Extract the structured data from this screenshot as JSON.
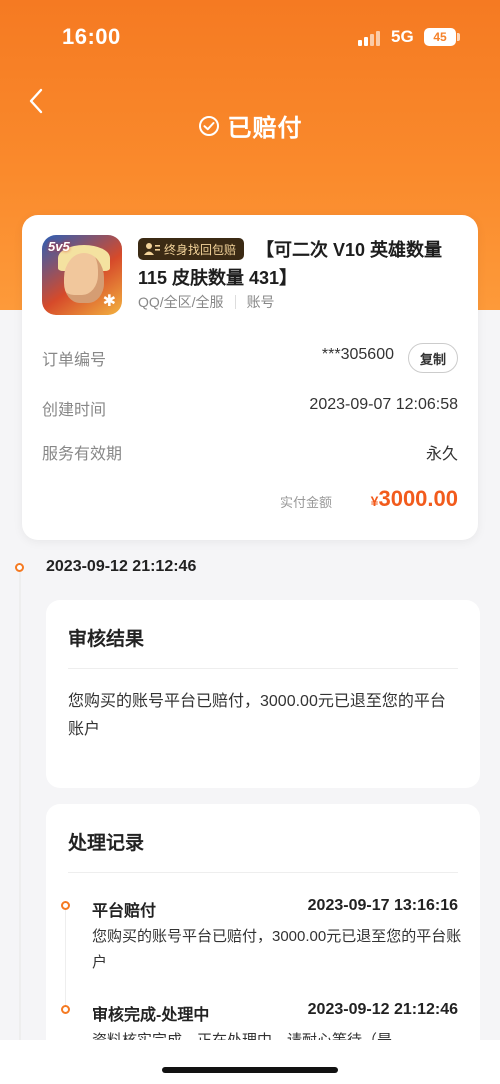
{
  "status_bar": {
    "time": "16:00",
    "network": "5G",
    "battery": "45"
  },
  "header": {
    "title": "已赔付",
    "back_icon": "chevron-left-icon",
    "status_icon": "check-circle-icon"
  },
  "order": {
    "badge": "终身找回包赔",
    "product_title": "【可二次 V10 英雄数量 115 皮肤数量 431】",
    "region": "QQ/全区/全服",
    "category": "账号",
    "rows": [
      {
        "label": "订单编号",
        "value": "***305600"
      },
      {
        "label": "创建时间",
        "value": "2023-09-07 12:06:58"
      },
      {
        "label": "服务有效期",
        "value": "永久"
      }
    ],
    "copy_label": "复制",
    "paid_label": "实付金额",
    "currency": "¥",
    "paid_amount": "3000.00"
  },
  "timeline": {
    "date": "2023-09-12 21:12:46",
    "review": {
      "title": "审核结果",
      "text": "您购买的账号平台已赔付，3000.00元已退至您的平台账户"
    },
    "records": {
      "title": "处理记录",
      "items": [
        {
          "title": "平台赔付",
          "time": "2023-09-17 13:16:16",
          "desc": "您购买的账号平台已赔付，3000.00元已退至您的平台账户"
        },
        {
          "title": "审核完成-处理中",
          "time": "2023-09-12 21:12:46",
          "desc": "资料核实完成，正在处理中，请耐心等待（是"
        }
      ]
    }
  },
  "colors": {
    "accent": "#f57a22",
    "price": "#f25b1c"
  }
}
